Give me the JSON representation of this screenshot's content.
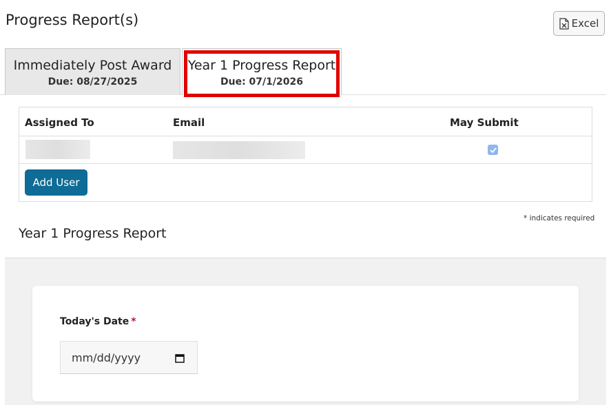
{
  "page_title": "Progress Report(s)",
  "excel_button": {
    "label": "Excel",
    "icon": "excel-file-icon"
  },
  "tabs": [
    {
      "title": "Immediately Post Award",
      "due": "Due: 08/27/2025",
      "active": false
    },
    {
      "title": "Year 1 Progress Report",
      "due": "Due: 07/1/2026",
      "active": true
    }
  ],
  "users_table": {
    "headers": {
      "assigned_to": "Assigned To",
      "email": "Email",
      "may_submit": "May Submit"
    },
    "rows": [
      {
        "assigned_to": "",
        "email": "",
        "may_submit": true
      }
    ],
    "add_user_label": "Add User"
  },
  "required_note": "* indicates required",
  "section_title": "Year 1 Progress Report",
  "form": {
    "todays_date": {
      "label": "Today's Date",
      "required_marker": "*",
      "placeholder": "mm/dd/yyyy",
      "icon": "calendar-icon"
    }
  },
  "colors": {
    "highlight": "#e00000",
    "primary_button": "#0e6c96",
    "checkbox": "#8fb6ee",
    "required": "#c0143c"
  }
}
